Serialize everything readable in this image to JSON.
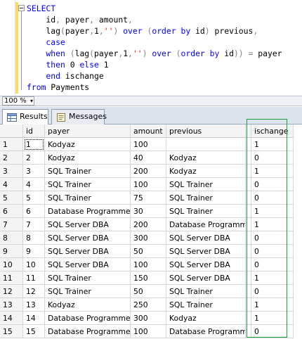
{
  "editor": {
    "lines": [
      [
        {
          "c": "kw",
          "t": "SELECT"
        }
      ],
      [
        {
          "c": "tx",
          "t": "    id"
        },
        {
          "c": "op",
          "t": ","
        },
        {
          "c": "tx",
          "t": " payer"
        },
        {
          "c": "op",
          "t": ","
        },
        {
          "c": "tx",
          "t": " amount"
        },
        {
          "c": "op",
          "t": ","
        }
      ],
      [
        {
          "c": "tx",
          "t": "    lag"
        },
        {
          "c": "op",
          "t": "("
        },
        {
          "c": "tx",
          "t": "payer"
        },
        {
          "c": "op",
          "t": ","
        },
        {
          "c": "tx",
          "t": "1"
        },
        {
          "c": "op",
          "t": ","
        },
        {
          "c": "str",
          "t": "''"
        },
        {
          "c": "op",
          "t": ")"
        },
        {
          "c": "kw",
          "t": " over "
        },
        {
          "c": "op",
          "t": "("
        },
        {
          "c": "kw",
          "t": "order by"
        },
        {
          "c": "tx",
          "t": " id"
        },
        {
          "c": "op",
          "t": ")"
        },
        {
          "c": "tx",
          "t": " previous"
        },
        {
          "c": "op",
          "t": ","
        }
      ],
      [
        {
          "c": "kw",
          "t": "    case"
        }
      ],
      [
        {
          "c": "kw",
          "t": "    when "
        },
        {
          "c": "op",
          "t": "("
        },
        {
          "c": "tx",
          "t": "lag"
        },
        {
          "c": "op",
          "t": "("
        },
        {
          "c": "tx",
          "t": "payer"
        },
        {
          "c": "op",
          "t": ","
        },
        {
          "c": "tx",
          "t": "1"
        },
        {
          "c": "op",
          "t": ","
        },
        {
          "c": "str",
          "t": "''"
        },
        {
          "c": "op",
          "t": ")"
        },
        {
          "c": "kw",
          "t": " over "
        },
        {
          "c": "op",
          "t": "("
        },
        {
          "c": "kw",
          "t": "order by"
        },
        {
          "c": "tx",
          "t": " id"
        },
        {
          "c": "op",
          "t": "))"
        },
        {
          "c": "op",
          "t": " ="
        },
        {
          "c": "tx",
          "t": " payer"
        }
      ],
      [
        {
          "c": "kw",
          "t": "    then "
        },
        {
          "c": "tx",
          "t": "0"
        },
        {
          "c": "kw",
          "t": " else "
        },
        {
          "c": "tx",
          "t": "1"
        }
      ],
      [
        {
          "c": "kw",
          "t": "    end"
        },
        {
          "c": "tx",
          "t": " ischange"
        }
      ],
      [
        {
          "c": "kw",
          "t": "from"
        },
        {
          "c": "tx",
          "t": " Payments"
        }
      ]
    ]
  },
  "zoom": {
    "value": "100 %"
  },
  "tabs": [
    {
      "label": "Results",
      "active": true,
      "icon": "results-grid-icon"
    },
    {
      "label": "Messages",
      "active": false,
      "icon": "messages-icon"
    }
  ],
  "grid": {
    "columns": [
      "id",
      "payer",
      "amount",
      "previous",
      "ischange"
    ],
    "rows": [
      [
        "1",
        "1",
        "Kodyaz",
        "100",
        "",
        "1"
      ],
      [
        "2",
        "2",
        "Kodyaz",
        "40",
        "Kodyaz",
        "0"
      ],
      [
        "3",
        "3",
        "SQL Trainer",
        "200",
        "Kodyaz",
        "1"
      ],
      [
        "4",
        "4",
        "SQL Trainer",
        "100",
        "SQL Trainer",
        "0"
      ],
      [
        "5",
        "5",
        "SQL Trainer",
        "75",
        "SQL Trainer",
        "0"
      ],
      [
        "6",
        "6",
        "Database Programmer",
        "30",
        "SQL Trainer",
        "1"
      ],
      [
        "7",
        "7",
        "SQL Server DBA",
        "200",
        "Database Programmer",
        "1"
      ],
      [
        "8",
        "8",
        "SQL Server DBA",
        "300",
        "SQL Server DBA",
        "0"
      ],
      [
        "9",
        "9",
        "SQL Server DBA",
        "50",
        "SQL Server DBA",
        "0"
      ],
      [
        "10",
        "10",
        "SQL Server DBA",
        "100",
        "SQL Server DBA",
        "0"
      ],
      [
        "11",
        "11",
        "SQL Trainer",
        "150",
        "SQL Server DBA",
        "1"
      ],
      [
        "12",
        "12",
        "SQL Trainer",
        "50",
        "SQL Trainer",
        "0"
      ],
      [
        "13",
        "13",
        "Kodyaz",
        "250",
        "SQL Trainer",
        "1"
      ],
      [
        "14",
        "14",
        "Database Programmer",
        "300",
        "Kodyaz",
        "1"
      ],
      [
        "15",
        "15",
        "Database Programmer",
        "100",
        "Database Programmer",
        "0"
      ]
    ]
  },
  "colors": {
    "highlight_box": "#1b9e3e",
    "keyword": "#0000ff",
    "string": "#ff0000",
    "function": "#ff00ff"
  }
}
